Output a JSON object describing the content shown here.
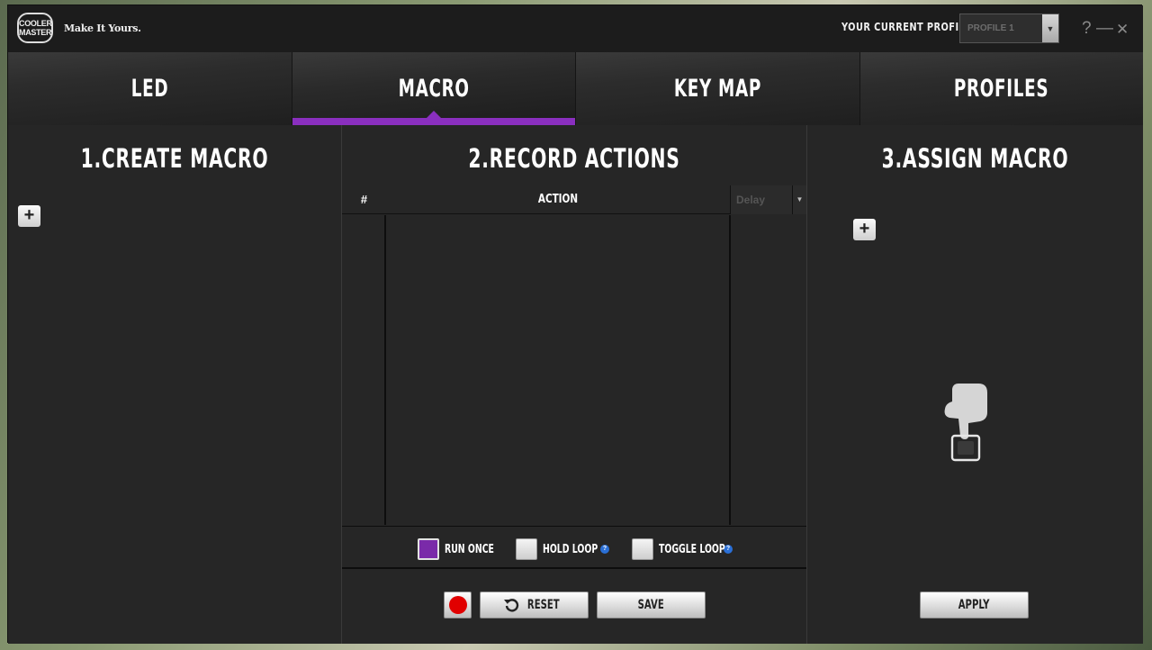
{
  "brand": {
    "logo_text": "COOLER MASTER",
    "slogan": "Make It Yours."
  },
  "header": {
    "profile_label": "YOUR CURRENT PROFILE",
    "profile_value": "PROFILE 1",
    "help": "?",
    "minimize": "—",
    "close": "✕"
  },
  "tabs": [
    {
      "label": "LED",
      "active": false
    },
    {
      "label": "MACRO",
      "active": true
    },
    {
      "label": "KEY MAP",
      "active": false
    },
    {
      "label": "PROFILES",
      "active": false
    }
  ],
  "create_macro": {
    "title": "1.CREATE MACRO",
    "add": "+"
  },
  "record_actions": {
    "title": "2.RECORD ACTIONS",
    "columns": {
      "num": "#",
      "action": "ACTION",
      "delay": "Delay"
    },
    "options": [
      {
        "label": "RUN ONCE",
        "checked": true
      },
      {
        "label": "HOLD LOOP",
        "checked": false
      },
      {
        "label": "TOGGLE LOOP",
        "checked": false
      }
    ],
    "help": "?",
    "reset_label": "RESET",
    "save_label": "SAVE"
  },
  "assign_macro": {
    "title": "3.ASSIGN MACRO",
    "add": "+",
    "apply_label": "APPLY"
  },
  "colors": {
    "accent": "#8a2fbf",
    "record": "#e10000",
    "background": "#262626"
  }
}
